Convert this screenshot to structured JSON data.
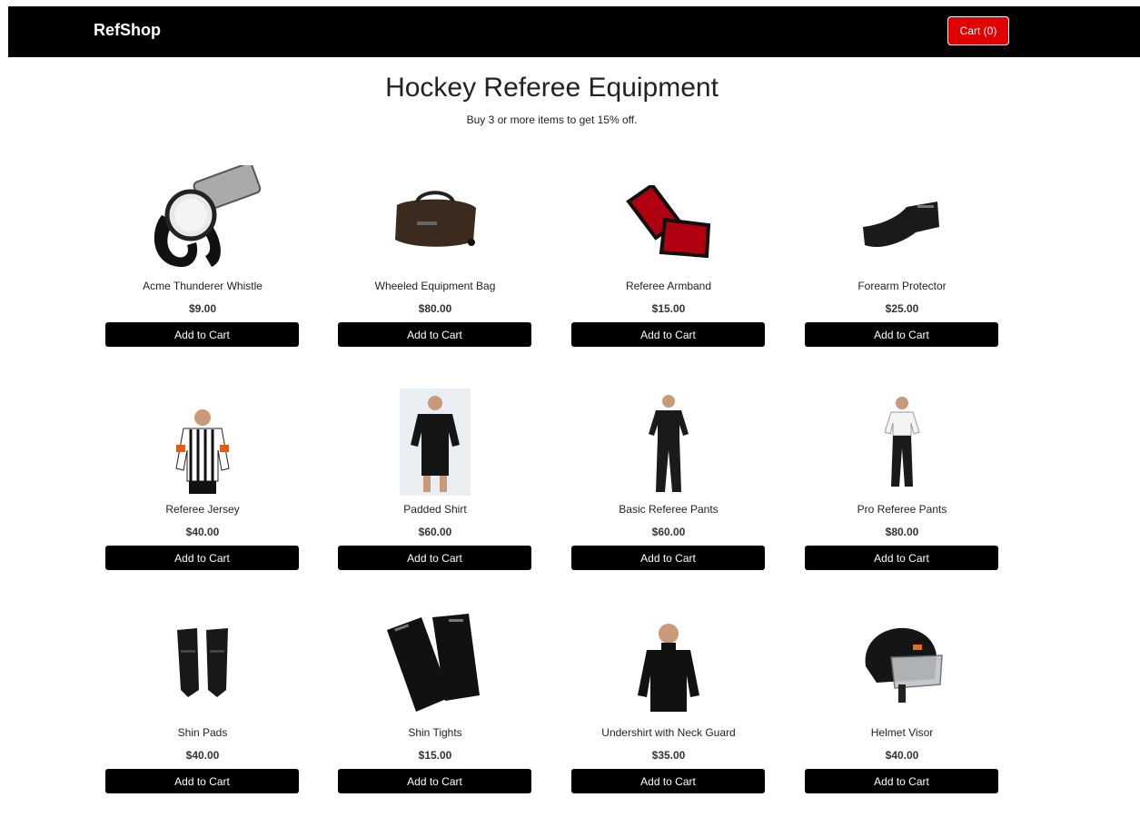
{
  "header": {
    "brand": "RefShop",
    "cart_label": "Cart (0)",
    "background_color": "#000000",
    "cart_color": "#e00000"
  },
  "main": {
    "title": "Hockey Referee Equipment",
    "subtitle": "Buy 3 or more items to get 15% off."
  },
  "products": [
    {
      "name": "Acme Thunderer Whistle",
      "price": "$9.00",
      "button": "Add to Cart",
      "icon": "whistle-icon"
    },
    {
      "name": "Wheeled Equipment Bag",
      "price": "$80.00",
      "button": "Add to Cart",
      "icon": "equipment-bag-icon"
    },
    {
      "name": "Referee Armband",
      "price": "$15.00",
      "button": "Add to Cart",
      "icon": "armband-icon"
    },
    {
      "name": "Forearm Protector",
      "price": "$25.00",
      "button": "Add to Cart",
      "icon": "forearm-protector-icon"
    },
    {
      "name": "Referee Jersey",
      "price": "$40.00",
      "button": "Add to Cart",
      "icon": "referee-jersey-icon"
    },
    {
      "name": "Padded Shirt",
      "price": "$60.00",
      "button": "Add to Cart",
      "icon": "padded-shirt-icon"
    },
    {
      "name": "Basic Referee Pants",
      "price": "$60.00",
      "button": "Add to Cart",
      "icon": "referee-pants-icon"
    },
    {
      "name": "Pro Referee Pants",
      "price": "$80.00",
      "button": "Add to Cart",
      "icon": "pro-pants-icon"
    },
    {
      "name": "Shin Pads",
      "price": "$40.00",
      "button": "Add to Cart",
      "icon": "shin-pads-icon"
    },
    {
      "name": "Shin Tights",
      "price": "$15.00",
      "button": "Add to Cart",
      "icon": "shin-tights-icon"
    },
    {
      "name": "Undershirt with Neck Guard",
      "price": "$35.00",
      "button": "Add to Cart",
      "icon": "undershirt-icon"
    },
    {
      "name": "Helmet Visor",
      "price": "$40.00",
      "button": "Add to Cart",
      "icon": "helmet-visor-icon"
    }
  ]
}
